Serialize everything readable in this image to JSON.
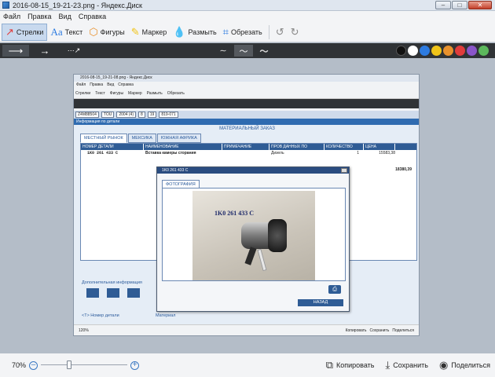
{
  "window": {
    "title": "2016-08-15_19-21-23.png - Яндекс.Диск"
  },
  "menu": [
    "Файл",
    "Правка",
    "Вид",
    "Справка"
  ],
  "toolbar": {
    "arrows": "Стрелки",
    "text": "Текст",
    "shapes": "Фигуры",
    "marker": "Маркер",
    "blur": "Размыть",
    "crop": "Обрезать"
  },
  "palette": [
    "#111111",
    "#ffffff",
    "#2d7be0",
    "#f0c419",
    "#e8912d",
    "#e03c3c",
    "#8a55c9",
    "#5cb85c"
  ],
  "inner": {
    "title": "2016-08-15_19-21-08.png - Яндекс.Диск",
    "menu": [
      "Файл",
      "Правка",
      "Вид",
      "Справка"
    ],
    "toolbar": [
      "Стрелки",
      "Текст",
      "Фигуры",
      "Маркер",
      "Размыть",
      "Обрезать"
    ],
    "filters": [
      "Z4M88504",
      "TOU",
      "2004 (4)",
      "8",
      "19",
      "819-071"
    ],
    "info_label": "Информация по детали",
    "order_header": "МАТЕРИАЛЬНЫЙ ЗАКАЗ",
    "tabs": [
      "МЕСТНЫЙ РЫНОК",
      "МЕКСИКА",
      "ЮЖНАЯ АФРИКА"
    ],
    "columns": [
      "НОМЕР ДЕТАЛИ",
      "НАИМЕНОВАНИЕ",
      "ПРИМЕЧАНИЕ",
      "ПРОВ ДАННЫХ ПО МОДЕЛИ",
      "КОЛИЧЕСТВО",
      "ЦЕНА"
    ],
    "row": {
      "part": "1K0 261 433 C",
      "name": "Вставка камеры сгорания",
      "model": "Дизель",
      "qty": "1",
      "price": "15583,38"
    },
    "total": "18380,39",
    "extra_info": "Дополнительная информация",
    "part_number_label": "<T> Номер детали",
    "material_label": "Материал",
    "zoom": "120%",
    "actions": [
      "Копировать",
      "Сохранить",
      "Поделиться"
    ],
    "popup": {
      "title": "1K0 261 433 C",
      "tab": "ФОТОГРАФИЯ",
      "photo_label": "1K0 261 433 C",
      "back": "НАЗАД"
    }
  },
  "status": {
    "zoom_label": "70%",
    "zoom_value": 70,
    "copy": "Копировать",
    "save": "Сохранить",
    "share": "Поделиться"
  }
}
